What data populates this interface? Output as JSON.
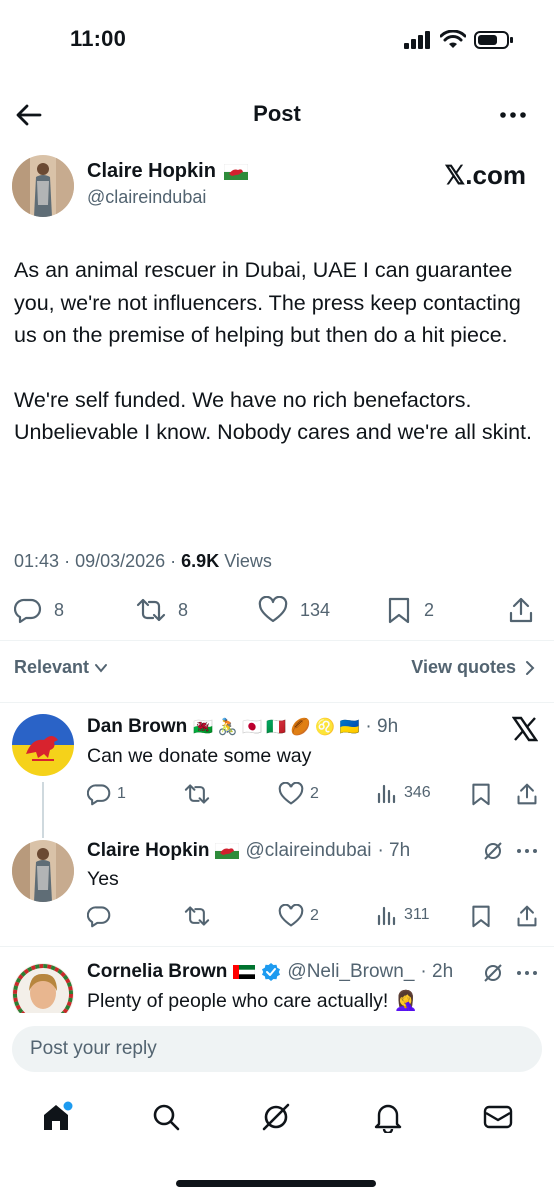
{
  "status_bar": {
    "time": "11:00"
  },
  "header": {
    "title": "Post"
  },
  "tweet": {
    "author_name": "Claire Hopkin",
    "author_flag": "wales-flag",
    "handle": "@claireindubai",
    "watermark": "𝕏.com",
    "paragraphs": [
      "As an animal rescuer in Dubai, UAE I can guarantee you, we're not influencers. The press keep contacting us on the premise of helping but then do a hit piece.",
      "We're self funded. We have no rich benefactors. Unbelievable I know. Nobody cares and we're all skint."
    ],
    "time": "01:43",
    "date": "09/03/2026",
    "views_count": "6.9K",
    "views_label": "Views",
    "replies": "8",
    "reposts": "8",
    "likes": "134",
    "bookmarks": "2"
  },
  "sort": {
    "label": "Relevant",
    "view_quotes": "View quotes"
  },
  "replies": [
    {
      "name": "Dan Brown",
      "emoji": "🏴󠁧󠁢󠁷󠁬󠁳󠁿 🚴 🇯🇵 🇮🇹 🏉 ♌ 🇺🇦",
      "time": "· 9h",
      "text": "Can we donate some way",
      "replies": "1",
      "likes": "2",
      "views": "346"
    },
    {
      "name": "Claire Hopkin",
      "handle": "@claireindubai",
      "time": "· 7h",
      "text": "Yes",
      "likes": "2",
      "views": "311"
    },
    {
      "name": "Cornelia Brown",
      "handle": "@Neli_Brown_",
      "time": "· 2h",
      "text": "Plenty of people who care actually! 🤦‍♀️"
    }
  ],
  "composer": {
    "placeholder": "Post your reply"
  },
  "nav": [
    "home-icon",
    "search-icon",
    "grok-icon",
    "notifications-icon",
    "messages-icon"
  ],
  "colors": {
    "accent": "#1d9bf0",
    "text": "#0f1419",
    "secondary": "#536471",
    "divider": "#eff3f4"
  }
}
